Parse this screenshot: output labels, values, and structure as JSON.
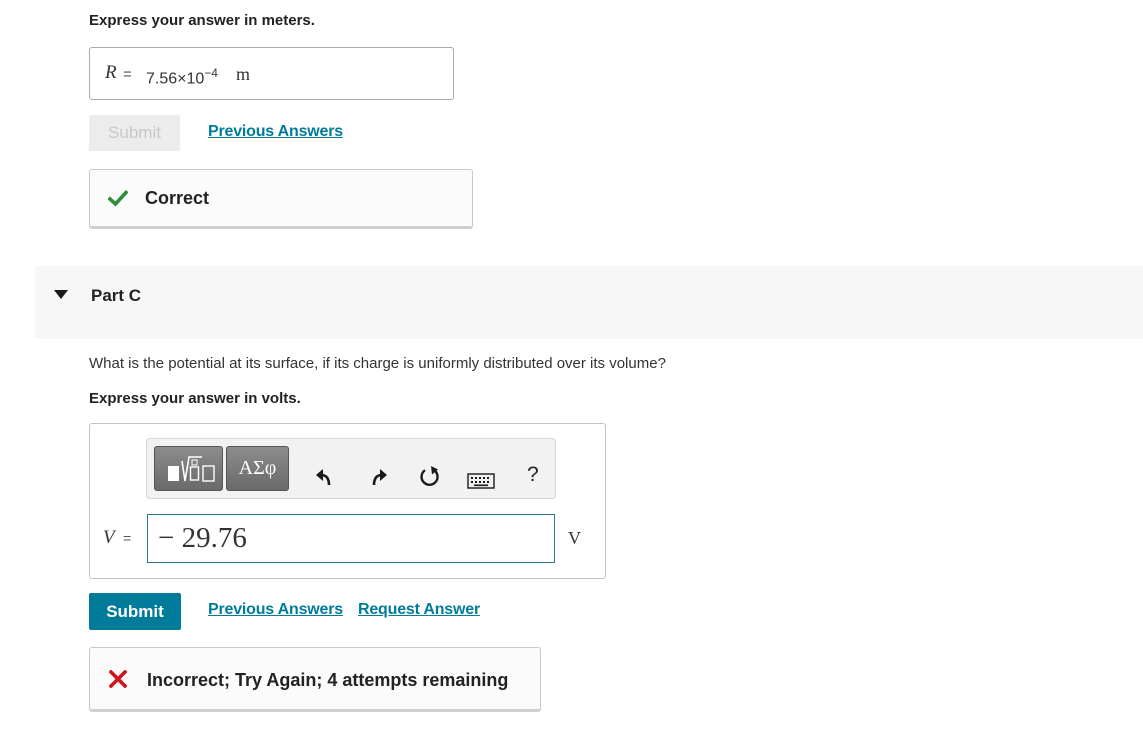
{
  "part_b": {
    "instruction": "Express your answer in meters.",
    "answer": {
      "variable": "R",
      "equals": "=",
      "mantissa": "7.56×10",
      "exponent": "−4",
      "unit": "m"
    },
    "submit_label": "Submit",
    "previous_answers_label": "Previous Answers",
    "feedback": {
      "text": "Correct",
      "status": "correct",
      "color": "#2e8b3a"
    }
  },
  "part_c": {
    "title": "Part C",
    "question": "What is the potential at its surface, if its charge is uniformly distributed over its volume?",
    "instruction": "Express your answer in volts.",
    "toolbar": {
      "template_icon": "templates-icon",
      "symbols_label": "ΑΣφ",
      "undo_icon": "undo-icon",
      "redo_icon": "redo-icon",
      "reset_icon": "reset-icon",
      "keyboard_icon": "keyboard-icon",
      "help_label": "?"
    },
    "answer": {
      "variable": "V",
      "equals": "=",
      "value": "− 29.76",
      "unit": "V"
    },
    "submit_label": "Submit",
    "previous_answers_label": "Previous Answers",
    "request_answer_label": "Request Answer",
    "feedback": {
      "text": "Incorrect; Try Again; 4 attempts remaining",
      "status": "incorrect",
      "color": "#d0141c"
    }
  },
  "colors": {
    "accent": "#007c9a",
    "input_border": "#26798e"
  }
}
